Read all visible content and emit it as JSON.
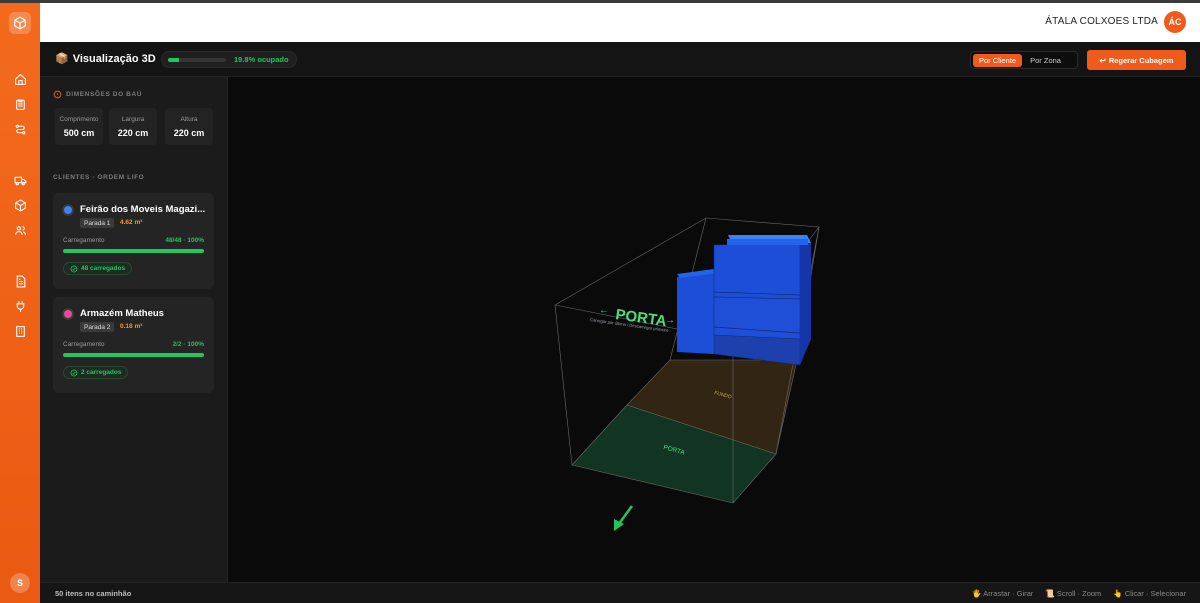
{
  "header": {
    "company": "ÁTALA COLXOES LTDA",
    "user_initials": "ÁC"
  },
  "rail": {
    "avatar_initial": "S",
    "icons": [
      "home-icon",
      "clipboard-icon",
      "route-icon",
      "truck-icon",
      "box-icon",
      "users-icon",
      "report-icon",
      "plug-icon",
      "building-icon"
    ]
  },
  "toolbar": {
    "title": "Visualização 3D",
    "occupancy_text": "19.8% ocupado",
    "occupancy_fraction": 0.198,
    "view_options": [
      "Por Cliente",
      "Por Zona"
    ],
    "active_view": "Por Cliente",
    "regen_label": "Regerar Cubagem"
  },
  "dimensions": {
    "heading": "DIMENSÕES DO BAÚ",
    "items": [
      {
        "label": "Comprimento",
        "value": "500 cm"
      },
      {
        "label": "Largura",
        "value": "220 cm"
      },
      {
        "label": "Altura",
        "value": "220 cm"
      }
    ]
  },
  "clients": {
    "heading": "CLIENTES - ORDEM LIFO",
    "items": [
      {
        "name": "Feirão dos Moveis Magazi...",
        "color": "#3b82f6",
        "stop": "Parada 1",
        "volume": "4.62 m³",
        "loading_label": "Carregamento",
        "loading_value": "48/48 · 100%",
        "loading_fraction": 1.0,
        "badge": "48 carregados"
      },
      {
        "name": "Armazém Matheus",
        "color": "#ec4899",
        "stop": "Parada 2",
        "volume": "0.18 m³",
        "loading_label": "Carregamento",
        "loading_value": "2/2 · 100%",
        "loading_fraction": 1.0,
        "badge": "2 carregados"
      }
    ]
  },
  "scene": {
    "porta_label": "PORTA",
    "porta_sub": "Carregar por última / Descarregar primeiro",
    "floor_porta": "PORTA",
    "floor_fundo": "FUNDO"
  },
  "footer": {
    "items_count": "50 itens no caminhão",
    "hint_drag": "🖐 Arrastar · Girar",
    "hint_scroll": "📜 Scroll · Zoom",
    "hint_click": "👆 Clicar · Selecionar"
  }
}
